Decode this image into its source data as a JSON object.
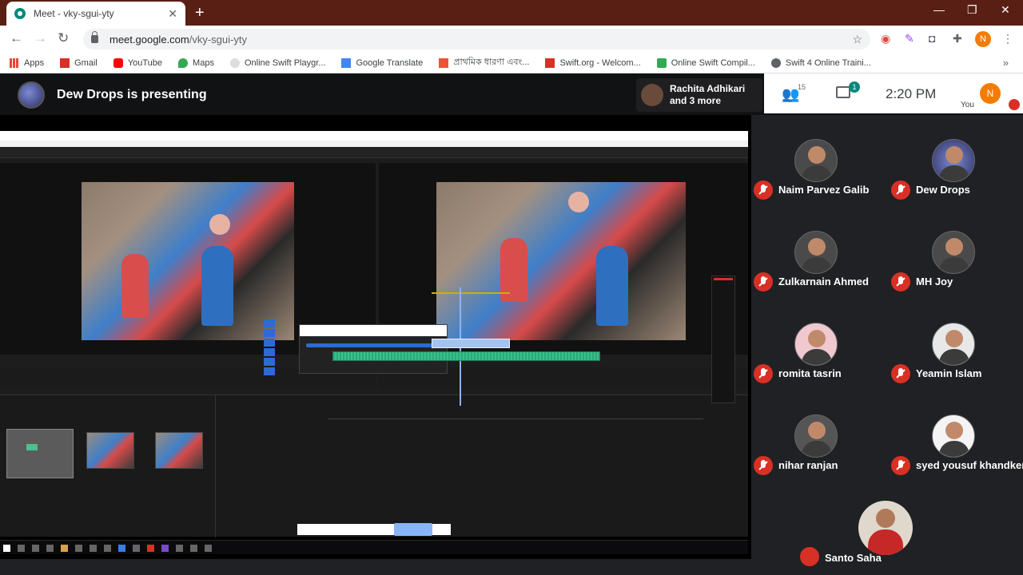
{
  "browser": {
    "tab_title": "Meet - vky-sgui-yty",
    "url_host": "meet.google.com",
    "url_path": "/vky-sgui-yty",
    "profile_initial": "N",
    "bookmarks": [
      {
        "label": "Apps",
        "color": "#e8453c"
      },
      {
        "label": "Gmail",
        "color": "#d93025"
      },
      {
        "label": "YouTube",
        "color": "#ff0000"
      },
      {
        "label": "Maps",
        "color": "#34a853"
      },
      {
        "label": "Online Swift Playgr...",
        "color": "#cccccc"
      },
      {
        "label": "Google Translate",
        "color": "#4285f4"
      },
      {
        "label": "প্রাথমিক ধারণা এবং...",
        "color": "#f05138"
      },
      {
        "label": "Swift.org - Welcom...",
        "color": "#d93025"
      },
      {
        "label": "Online Swift Compil...",
        "color": "#34a853"
      },
      {
        "label": "Swift 4 Online Traini...",
        "color": "#5f6368"
      }
    ]
  },
  "meet": {
    "presenting_text": "Dew Drops is presenting",
    "mini_tile_name": "Rachita Adhikari",
    "mini_tile_more": "and 3 more",
    "people_count": "15",
    "chat_badge": "1",
    "clock": "2:20 PM",
    "you_initial": "N",
    "you_label": "You",
    "participants": [
      {
        "name": "Naim Parvez Galib"
      },
      {
        "name": "Dew Drops"
      },
      {
        "name": "Zulkarnain Ahmed"
      },
      {
        "name": "MH Joy"
      },
      {
        "name": "romita tasrin"
      },
      {
        "name": "Yeamin Islam"
      },
      {
        "name": "nihar ranjan"
      },
      {
        "name": "syed yousuf khandker"
      }
    ],
    "self_name": "Santo Saha"
  }
}
